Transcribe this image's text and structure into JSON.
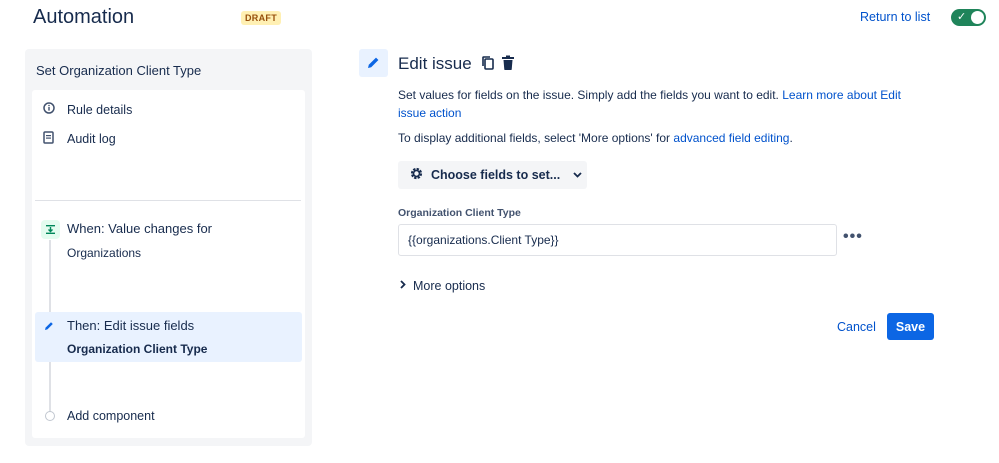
{
  "header": {
    "title": "Automation",
    "status_badge": "DRAFT",
    "return_link": "Return to list",
    "toggle_checkmark": "✓"
  },
  "sidebar": {
    "rule_name": "Set Organization Client Type",
    "items": [
      {
        "label": "Rule details",
        "icon": "info-icon"
      },
      {
        "label": "Audit log",
        "icon": "document-icon"
      }
    ],
    "trigger": {
      "title": "When: Value changes for",
      "subtitle": "Organizations",
      "icon": "trigger-icon"
    },
    "action": {
      "title": "Then: Edit issue fields",
      "subtitle": "Organization Client Type",
      "icon": "pencil-icon"
    },
    "add_component": "Add component"
  },
  "editor": {
    "title": "Edit issue",
    "description": "Set values for fields on the issue. Simply add the fields you want to edit. ",
    "learn_more_link": "Learn more about Edit issue action",
    "additional_text": "To display additional fields, select 'More options' for ",
    "advanced_link": "advanced field editing",
    "additional_suffix": ".",
    "choose_fields_button": "Choose fields to set...",
    "field": {
      "label": "Organization Client Type",
      "value": "{{organizations.Client Type}}"
    },
    "more_options": "More options",
    "cancel": "Cancel",
    "save": "Save"
  },
  "colors": {
    "accent": "#0c66e4",
    "link": "#0052cc",
    "toggle_on": "#1f845a",
    "draft_bg": "#fff0b3",
    "draft_text": "#974f0c"
  }
}
